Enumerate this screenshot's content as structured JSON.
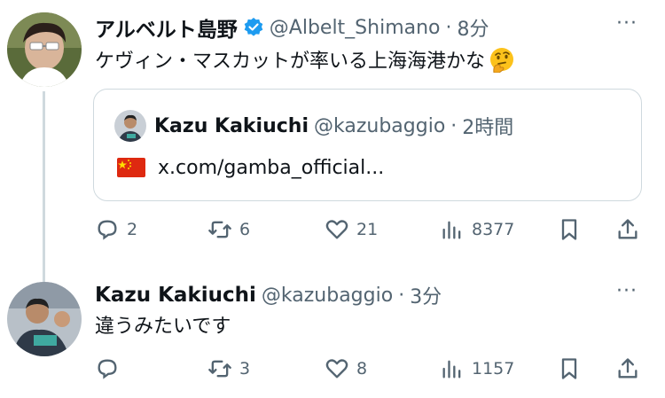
{
  "tweet1": {
    "display_name": "アルベルト島野",
    "handle": "@Albelt_Shimano",
    "time": "8分",
    "text": "ケヴィン・マスカットが率いる上海海港かな",
    "emoji": "thinking-face",
    "verified_color": "#1d9bf0",
    "quote": {
      "display_name": "Kazu Kakiuchi",
      "handle": "@kazubaggio",
      "time": "2時間",
      "flag": "cn-flag",
      "link_text": "x.com/gamba_official..."
    },
    "stats": {
      "replies": "2",
      "retweets": "6",
      "likes": "21",
      "views": "8377"
    }
  },
  "tweet2": {
    "display_name": "Kazu Kakiuchi",
    "handle": "@kazubaggio",
    "time": "3分",
    "text": "違うみたいです",
    "stats": {
      "replies": "",
      "retweets": "3",
      "likes": "8",
      "views": "1157"
    }
  },
  "ui": {
    "separator": "·",
    "more": "···"
  }
}
